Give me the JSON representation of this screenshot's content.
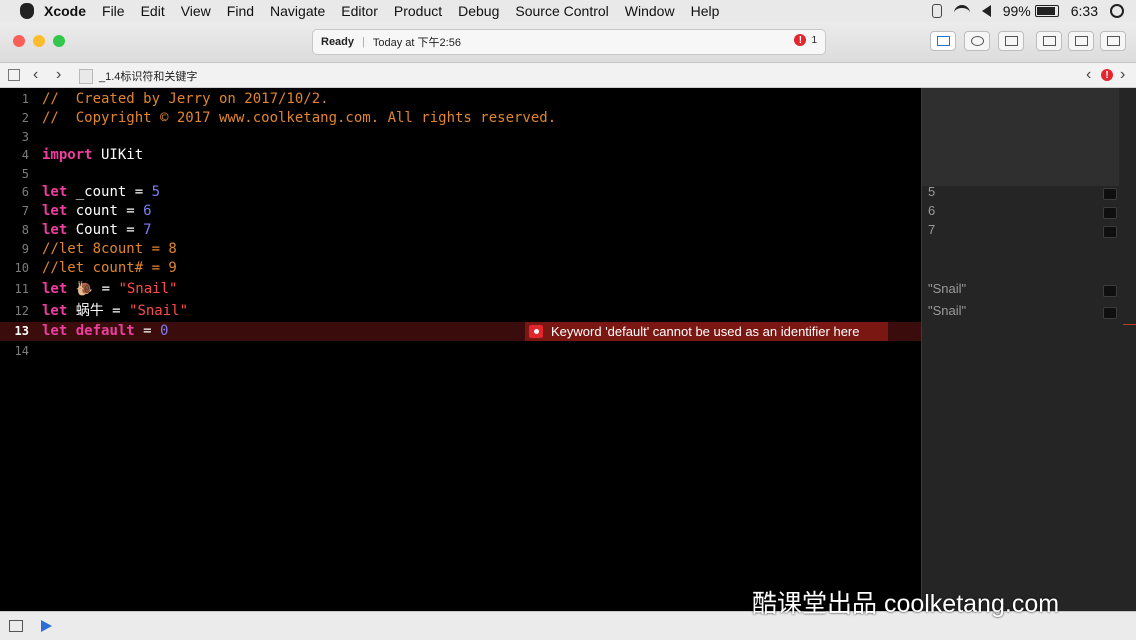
{
  "menubar": {
    "app": "Xcode",
    "items": [
      "File",
      "Edit",
      "View",
      "Find",
      "Navigate",
      "Editor",
      "Product",
      "Debug",
      "Source Control",
      "Window",
      "Help"
    ],
    "battery": "99%",
    "time": "6:33"
  },
  "toolbar": {
    "status": "Ready",
    "timestamp": "Today at 下午2:56",
    "error_count": "1",
    "error_badge": "!"
  },
  "jumpbar": {
    "back": "‹",
    "forward": "›",
    "filename": "_1.4标识符和关键字",
    "issue_prev": "‹",
    "issue_next": "›"
  },
  "editor": {
    "lines": [
      {
        "n": "1",
        "seg": [
          {
            "t": "//  Created by Jerry on 2017/10/2.",
            "c": "cm"
          }
        ]
      },
      {
        "n": "2",
        "seg": [
          {
            "t": "//  Copyright © 2017 www.coolketang.com. All rights reserved.",
            "c": "cm"
          }
        ]
      },
      {
        "n": "3",
        "seg": []
      },
      {
        "n": "4",
        "seg": [
          {
            "t": "import",
            "c": "kw"
          },
          {
            "t": " UIKit",
            "c": ""
          }
        ]
      },
      {
        "n": "5",
        "seg": []
      },
      {
        "n": "6",
        "seg": [
          {
            "t": "let",
            "c": "kw"
          },
          {
            "t": " _count = ",
            "c": ""
          },
          {
            "t": "5",
            "c": "num"
          }
        ]
      },
      {
        "n": "7",
        "seg": [
          {
            "t": "let",
            "c": "kw"
          },
          {
            "t": " count = ",
            "c": ""
          },
          {
            "t": "6",
            "c": "num"
          }
        ]
      },
      {
        "n": "8",
        "seg": [
          {
            "t": "let",
            "c": "kw"
          },
          {
            "t": " Count = ",
            "c": ""
          },
          {
            "t": "7",
            "c": "num"
          }
        ]
      },
      {
        "n": "9",
        "seg": [
          {
            "t": "//let 8count = 8",
            "c": "cm"
          }
        ]
      },
      {
        "n": "10",
        "seg": [
          {
            "t": "//let count# = 9",
            "c": "cm"
          }
        ]
      },
      {
        "n": "11",
        "seg": [
          {
            "t": "let",
            "c": "kw"
          },
          {
            "t": " 🐌 = ",
            "c": ""
          },
          {
            "t": "\"Snail\"",
            "c": "str"
          }
        ]
      },
      {
        "n": "12",
        "seg": [
          {
            "t": "let",
            "c": "kw"
          },
          {
            "t": " 蜗牛 = ",
            "c": ""
          },
          {
            "t": "\"Snail\"",
            "c": "str"
          }
        ]
      },
      {
        "n": "13",
        "seg": [
          {
            "t": "let",
            "c": "kw"
          },
          {
            "t": " ",
            "c": ""
          },
          {
            "t": "default",
            "c": "kw"
          },
          {
            "t": " = ",
            "c": ""
          },
          {
            "t": "0",
            "c": "num"
          }
        ],
        "current": true
      },
      {
        "n": "14",
        "seg": []
      }
    ],
    "error_message": "Keyword 'default' cannot be used as an identifier here"
  },
  "results": [
    {
      "line": 6,
      "value": "5"
    },
    {
      "line": 7,
      "value": "6"
    },
    {
      "line": 8,
      "value": "7"
    },
    {
      "line": 11,
      "value": "\"Snail\""
    },
    {
      "line": 12,
      "value": "\"Snail\""
    }
  ],
  "watermark": "酷课堂出品 coolketang.com",
  "colors": {
    "keyword": "#ef3da0",
    "comment": "#e0852f",
    "number": "#7e7df5",
    "string": "#ff4b4b",
    "error": "#e1262d"
  }
}
